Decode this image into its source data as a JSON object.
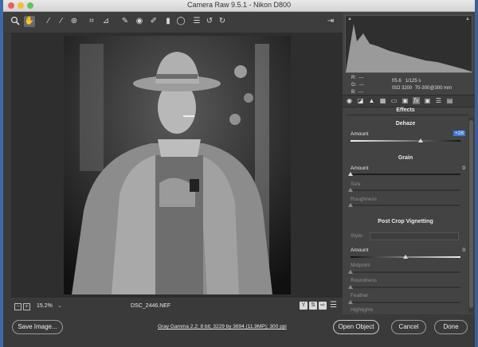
{
  "window": {
    "title": "Camera Raw 9.5.1  -  Nikon D800"
  },
  "toolbar": {
    "tools": [
      "zoom-icon",
      "hand-icon",
      "white-balance-icon",
      "color-sampler-icon",
      "target-adjustment-icon",
      "crop-icon",
      "straighten-icon",
      "spot-removal-icon",
      "red-eye-icon",
      "adjustment-brush-icon",
      "graduated-filter-icon",
      "radial-filter-icon",
      "preferences-icon",
      "rotate-ccw-icon",
      "rotate-cw-icon"
    ],
    "fullscreen_icon": "toggle-fullscreen-icon"
  },
  "image_info": {
    "r_label": "R:",
    "r_value": "---",
    "g_label": "G:",
    "g_value": "---",
    "b_label": "B:",
    "b_value": "---",
    "aperture": "f/5.6",
    "shutter": "1/125 s",
    "iso": "ISO 3200",
    "lens": "70-300@300 mm"
  },
  "panel": {
    "tabs": [
      "basic-icon",
      "tone-curve-icon",
      "detail-icon",
      "hsl-icon",
      "split-toning-icon",
      "lens-corrections-icon",
      "effects-icon",
      "camera-calibration-icon",
      "presets-icon",
      "snapshots-icon"
    ],
    "title": "Effects",
    "dehaze": {
      "heading": "Dehaze",
      "amount_label": "Amount",
      "amount_value": "+28",
      "amount": 28
    },
    "grain": {
      "heading": "Grain",
      "amount_label": "Amount",
      "amount_value": "0",
      "size_label": "Size",
      "roughness_label": "Roughness"
    },
    "vignette": {
      "heading": "Post Crop Vignetting",
      "style_label": "Style:",
      "amount_label": "Amount",
      "amount_value": "0",
      "midpoint_label": "Midpoint",
      "roundness_label": "Roundness",
      "feather_label": "Feather",
      "highlights_label": "Highlights"
    }
  },
  "statusbar": {
    "zoom": "15.2%",
    "filename": "DSC_2446.NEF"
  },
  "footer": {
    "save_label": "Save Image...",
    "workflow_link": "Gray Gamma 2.2; 8 bit; 3229 by 3694 (11.9MP); 300 ppi",
    "open_label": "Open Object",
    "cancel_label": "Cancel",
    "done_label": "Done"
  },
  "colors": {
    "accent": "#3b78d8",
    "panel_bg": "#434343",
    "window_bg": "#3a3a3a"
  }
}
